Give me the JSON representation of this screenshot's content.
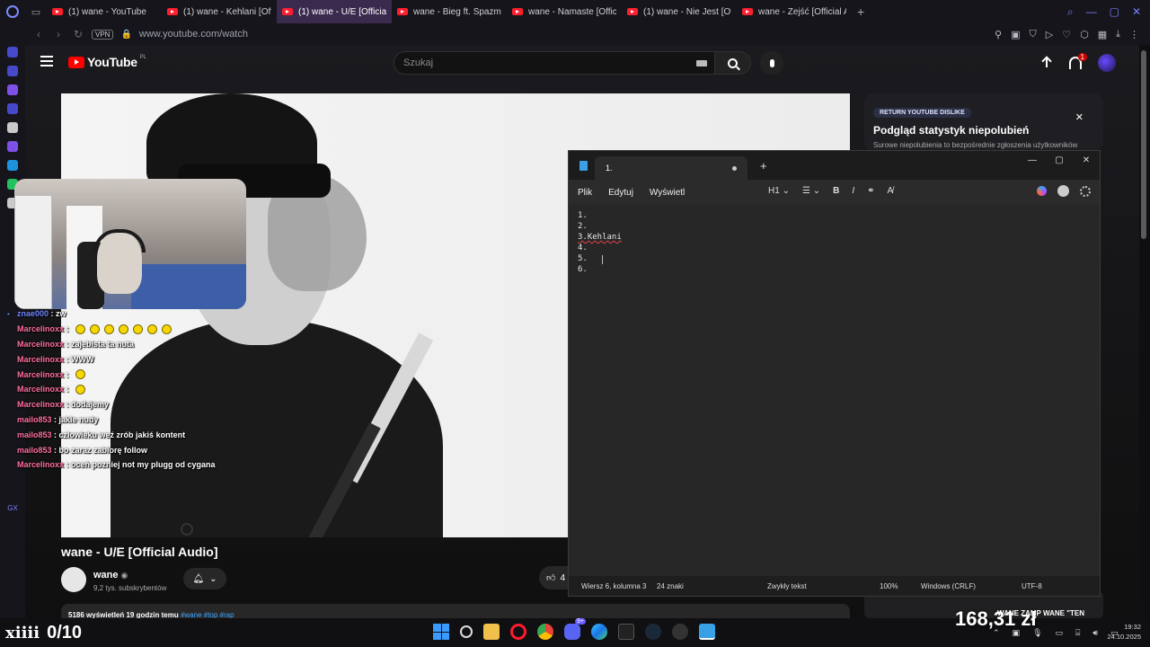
{
  "browser": {
    "tabs": [
      {
        "label": "(1) wane - YouTube",
        "active": false
      },
      {
        "label": "(1) wane - Kehlani [Official",
        "active": false
      },
      {
        "label": "(1) wane - U/E [Official Au",
        "active": true
      },
      {
        "label": "wane - Bieg ft. Spazma [",
        "active": false
      },
      {
        "label": "wane - Namaste [Official",
        "active": false
      },
      {
        "label": "(1) wane - Nie Jest [Offic",
        "active": false
      },
      {
        "label": "wane - Zejść [Official Aud",
        "active": false
      }
    ],
    "vpn_label": "VPN",
    "url": "www.youtube.com/watch"
  },
  "youtube": {
    "logo_text": "YouTube",
    "country_code": "PL",
    "search_placeholder": "Szukaj",
    "notification_count": "1",
    "video_title": "wane - U/E [Official Audio]",
    "channel_name": "wane",
    "subscribers": "9,2 tys. subskrybentów",
    "like_count": "4",
    "description": {
      "meta": "5186 wyświetleń  19 godzin temu",
      "tags": "#wane #top #rap"
    },
    "return_dislike": {
      "pill": "RETURN YOUTUBE DISLIKE",
      "title": "Podgląd statystyk niepolubień",
      "desc": "Surowe niepolubienia to bezpośrednie zgłoszenia użytkowników rozszerzenia oglądających ten film."
    },
    "recommended_title": "WANE ZAMP WANE \"TEN"
  },
  "stream": {
    "chat": [
      {
        "user": "znae000",
        "msg": "zw",
        "emotes": 0,
        "color": "blue"
      },
      {
        "user": "Marcelinoxx",
        "msg": "",
        "emotes": 7,
        "color": "pink"
      },
      {
        "user": "Marcelinoxx",
        "msg": "zajebista ta nuta",
        "emotes": 0,
        "color": "pink"
      },
      {
        "user": "Marcelinoxx",
        "msg": "WWW",
        "emotes": 0,
        "color": "pink"
      },
      {
        "user": "Marcelinoxx",
        "msg": "",
        "emotes": 1,
        "color": "pink"
      },
      {
        "user": "Marcelinoxx",
        "msg": "",
        "emotes": 1,
        "color": "pink"
      },
      {
        "user": "Marcelinoxx",
        "msg": "dodajemy",
        "emotes": 0,
        "color": "pink"
      },
      {
        "user": "mailo853",
        "msg": "jakie nudy",
        "emotes": 0,
        "color": "pink"
      },
      {
        "user": "mailo853",
        "msg": "człowieku weź zrób jakiś kontent",
        "emotes": 0,
        "color": "pink"
      },
      {
        "user": "mailo853",
        "msg": "bo zaraz zabiorę follow",
        "emotes": 0,
        "color": "pink"
      },
      {
        "user": "Marcelinoxx",
        "msg": "oceń pozniej not my plugg od cygana",
        "emotes": 0,
        "color": "pink"
      }
    ],
    "counter_logo": "xiiii",
    "counter_value": "0/10",
    "donation_amount": "168,31 zł"
  },
  "notepad": {
    "tab_title": "1.",
    "menu": [
      "Plik",
      "Edytuj",
      "Wyświetl"
    ],
    "heading_select": "H1",
    "lines": [
      "1.",
      "2.",
      "3.Kehlani",
      "4.",
      "5.",
      "6."
    ],
    "status": {
      "position": "Wiersz 6, kolumna 3",
      "chars": "24 znaki",
      "format": "Zwykły tekst",
      "zoom": "100%",
      "eol": "Windows (CRLF)",
      "encoding": "UTF-8"
    }
  },
  "taskbar": {
    "discord_badge": "9+",
    "time": "19:32",
    "date": "24.10.2025"
  },
  "sidebar": {
    "gx_label": "GX"
  }
}
